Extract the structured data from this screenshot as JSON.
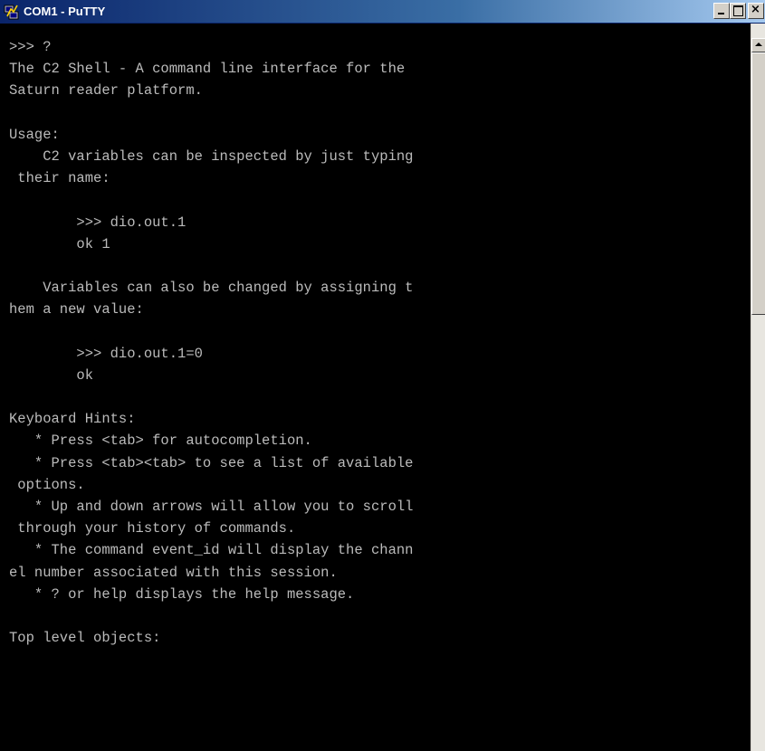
{
  "window": {
    "title": "COM1 - PuTTY",
    "close_glyph": "×"
  },
  "icons": {
    "app": "putty-icon",
    "minimize": "minimize-icon",
    "maximize": "maximize-icon",
    "close": "close-icon",
    "scroll_up": "arrow-up-icon"
  },
  "colors": {
    "terminal_bg": "#000000",
    "terminal_fg": "#bbbbbb",
    "titlebar_start": "#0a246a",
    "titlebar_end": "#a6caf0"
  },
  "terminal": {
    "lines": [
      ">>> ?",
      "The C2 Shell - A command line interface for the",
      "Saturn reader platform.",
      "",
      "Usage:",
      "    C2 variables can be inspected by just typing",
      " their name:",
      "",
      "        >>> dio.out.1",
      "        ok 1",
      "",
      "    Variables can also be changed by assigning t",
      "hem a new value:",
      "",
      "        >>> dio.out.1=0",
      "        ok",
      "",
      "Keyboard Hints:",
      "   * Press <tab> for autocompletion.",
      "   * Press <tab><tab> to see a list of available",
      " options.",
      "   * Up and down arrows will allow you to scroll",
      " through your history of commands.",
      "   * The command event_id will display the chann",
      "el number associated with this session.",
      "   * ? or help displays the help message.",
      "",
      "Top level objects:"
    ]
  }
}
